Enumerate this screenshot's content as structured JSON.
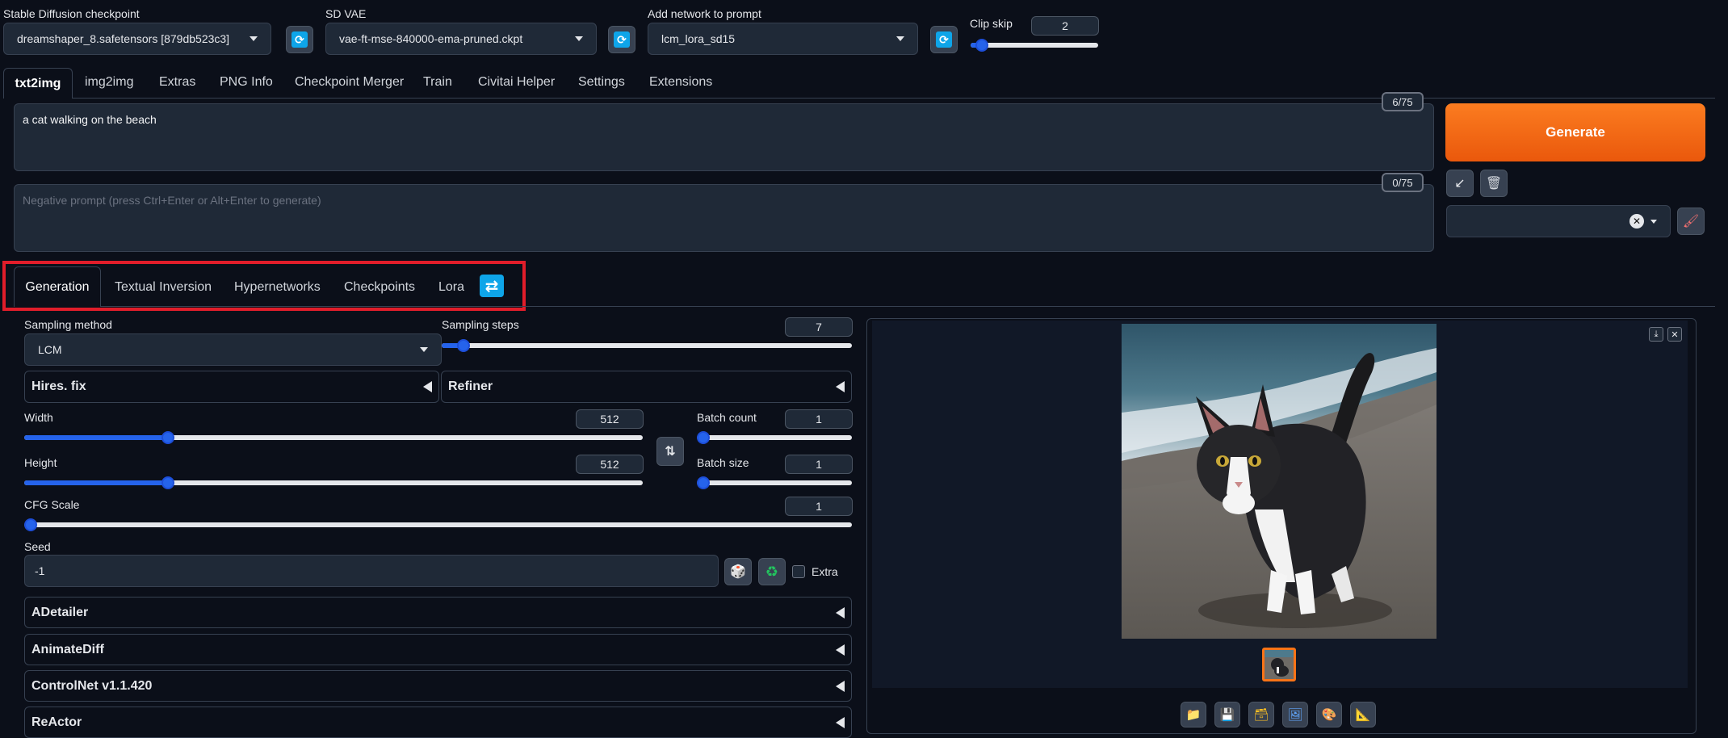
{
  "top": {
    "checkpoint_label": "Stable Diffusion checkpoint",
    "checkpoint_value": "dreamshaper_8.safetensors [879db523c3]",
    "vae_label": "SD VAE",
    "vae_value": "vae-ft-mse-840000-ema-pruned.ckpt",
    "network_label": "Add network to prompt",
    "network_value": "lcm_lora_sd15",
    "clip_skip_label": "Clip skip",
    "clip_skip_value": "2"
  },
  "main_tabs": [
    "txt2img",
    "img2img",
    "Extras",
    "PNG Info",
    "Checkpoint Merger",
    "Train",
    "Civitai Helper",
    "Settings",
    "Extensions"
  ],
  "prompt": {
    "text": "a cat walking on the beach",
    "token_count": "6/75",
    "negative_placeholder": "Negative prompt (press Ctrl+Enter or Alt+Enter to generate)",
    "negative_count": "0/75",
    "generate_label": "Generate"
  },
  "sub_tabs": [
    "Generation",
    "Textual Inversion",
    "Hypernetworks",
    "Checkpoints",
    "Lora"
  ],
  "generation": {
    "sampling_method_label": "Sampling method",
    "sampling_method_value": "LCM",
    "sampling_steps_label": "Sampling steps",
    "sampling_steps_value": "7",
    "hires_label": "Hires. fix",
    "refiner_label": "Refiner",
    "width_label": "Width",
    "width_value": "512",
    "height_label": "Height",
    "height_value": "512",
    "batch_count_label": "Batch count",
    "batch_count_value": "1",
    "batch_size_label": "Batch size",
    "batch_size_value": "1",
    "cfg_label": "CFG Scale",
    "cfg_value": "1",
    "seed_label": "Seed",
    "seed_value": "-1",
    "extra_label": "Extra",
    "accordions": [
      "ADetailer",
      "AnimateDiff",
      "ControlNet v1.1.420",
      "ReActor"
    ]
  },
  "colors": {
    "accent_orange": "#f97316",
    "slider_blue": "#2563eb",
    "highlight_red": "#e11d2a",
    "refresh_blue": "#0ea5e9"
  }
}
